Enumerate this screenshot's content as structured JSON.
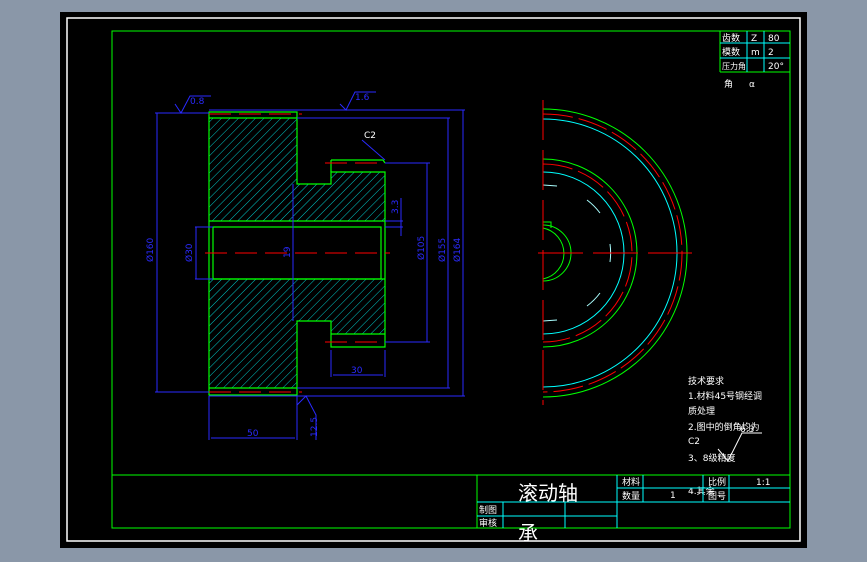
{
  "colors": {
    "background": "#8a97a8",
    "paper": "#000000",
    "outline": "#00ff00",
    "hatch": "#00ffff",
    "center": "#ff0000",
    "dimension": "#2a2aff",
    "text": "#ffffff"
  },
  "params": {
    "rows": [
      {
        "name": "齿数",
        "symbol": "Z",
        "value": "80"
      },
      {
        "name": "模数",
        "symbol": "m",
        "value": "2"
      },
      {
        "name": "压力角",
        "symbol": "",
        "value": "20°"
      },
      {
        "name": "角",
        "symbol": "α",
        "value": ""
      }
    ]
  },
  "dimensions": {
    "roughness_top_left": "0.8",
    "roughness_top_right": "1.6",
    "roughness_bottom": "12.5",
    "chamfer": "C2",
    "dia_outer_left": "Ø160",
    "dia_bore": "Ø30",
    "keyway": "19",
    "dia_hub": "Ø105",
    "dia_root": "Ø155",
    "dia_tip": "Ø164",
    "small": "3.3",
    "hub_width": "30",
    "rim_width": "50"
  },
  "tech_requirements": {
    "title": "技术要求",
    "lines": [
      "1.材料45号钢经调",
      "质处理",
      "2.图中的倒角均为",
      "C2",
      "3、8级精度",
      "4.其余"
    ],
    "roughness": "6.3"
  },
  "title_block": {
    "name_line1": "滚动轴",
    "name_line2": "承",
    "material_label": "材料",
    "quantity_label": "数量",
    "quantity": "1",
    "scale_label": "比例",
    "scale": "1:1",
    "drawing_no_label": "图号",
    "drawn_label": "制图",
    "checked_label": "审核"
  }
}
